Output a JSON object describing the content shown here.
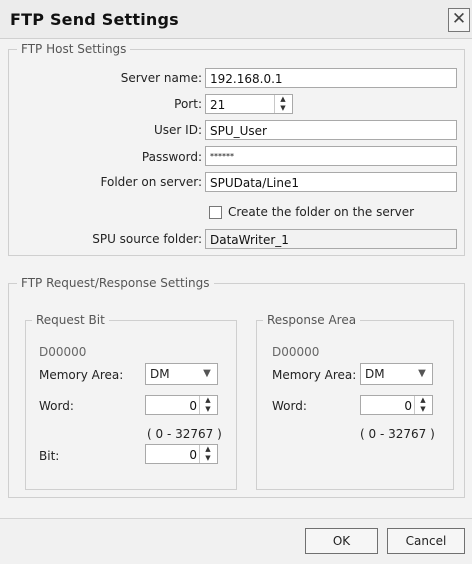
{
  "window": {
    "title": "FTP Send Settings",
    "close_glyph": "✕"
  },
  "host": {
    "legend": "FTP Host Settings",
    "server_name_label": "Server name:",
    "server_name_value": "192.168.0.1",
    "port_label": "Port:",
    "port_value": "21",
    "user_id_label": "User ID:",
    "user_id_value": "SPU_User",
    "password_label": "Password:",
    "password_value": "******",
    "folder_label": "Folder on server:",
    "folder_value": "SPUData/Line1",
    "create_folder_label": "Create the folder on the server",
    "create_folder_checked": false,
    "source_folder_label": "SPU source folder:",
    "source_folder_value": "DataWriter_1"
  },
  "reqresp": {
    "legend": "FTP Request/Response Settings",
    "request": {
      "legend": "Request Bit",
      "address": "D00000",
      "memory_area_label": "Memory Area:",
      "memory_area_value": "DM",
      "word_label": "Word:",
      "word_value": "0",
      "range": "( 0 - 32767 )",
      "bit_label": "Bit:",
      "bit_value": "0"
    },
    "response": {
      "legend": "Response Area",
      "address": "D00000",
      "memory_area_label": "Memory Area:",
      "memory_area_value": "DM",
      "word_label": "Word:",
      "word_value": "0",
      "range": "( 0 - 32767 )"
    }
  },
  "buttons": {
    "ok": "OK",
    "cancel": "Cancel"
  },
  "icons": {
    "spin_up": "▲",
    "spin_down": "▼",
    "dropdown": "▼"
  }
}
